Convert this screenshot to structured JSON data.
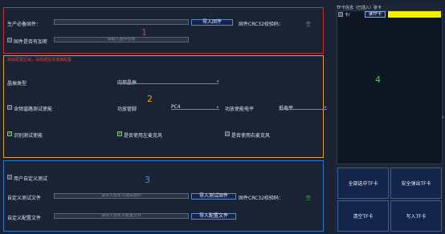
{
  "colors": {
    "bg": "#1a2333",
    "red": "#c8302c",
    "orange": "#e0a030",
    "blue": "#2f78c8",
    "green": "#3fdc4f",
    "yellow": "#f2f200"
  },
  "panel1": {
    "number": "1",
    "firmware_label": "生产必备固件：",
    "import_btn": "导入固件",
    "crc_label": "固件CRC32校验码：",
    "crc_value": "空",
    "encrypt_label": "固件是否有加密",
    "password_placeholder": "请输入固件密码"
  },
  "panel2": {
    "number": "2",
    "warning": "高级配置区域，请根据需求谨慎配置",
    "crystal_label": "晶振类型",
    "crystal_value": "内部晶振",
    "short_test_label": "含频谐路测试使能",
    "power_pin_label": "功放管脚",
    "power_pin_value": "PC4",
    "enable_level_label": "功放使能电平",
    "enable_level_value": "低电平",
    "recognize_label": "识别测试使能",
    "left_mic_label": "是否使用左麦克风",
    "right_mic_label": "是否使用右麦克风"
  },
  "panel3": {
    "number": "3",
    "custom_test_label": "用户自定义测试",
    "custom_firmware_label": "自定义测试文件",
    "custom_firmware_placeholder": "请导入自定义测试固件",
    "import_test_btn": "导入测试固件",
    "crc_label": "固件CRC32校验码：",
    "crc_value": "空",
    "custom_config_label": "自定义配置文件",
    "custom_config_placeholder": "请导入自定义配置文件",
    "import_config_btn": "导入配置文件"
  },
  "panel4": {
    "number": "4",
    "tf_header": "TF卡信息（已插入）张卡",
    "tf_row_label": "卡/",
    "tf_read_btn": "读TF卡",
    "select_all_btn": "全部选中TF卡",
    "eject_btn": "安全弹出TF卡",
    "clear_btn": "清空TF卡",
    "write_btn": "写入TF卡"
  },
  "edge_arrow": "‹"
}
